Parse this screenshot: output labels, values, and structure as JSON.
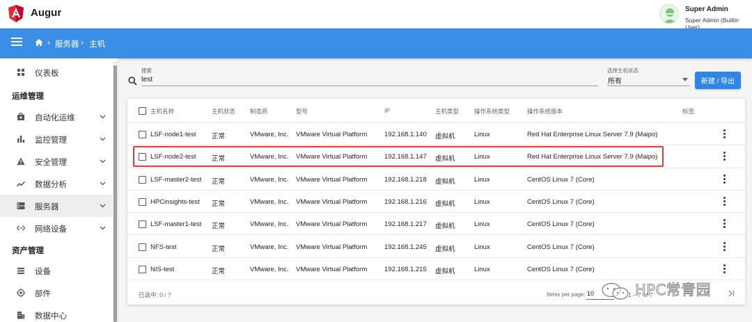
{
  "app": {
    "title": "Augur"
  },
  "user": {
    "name": "Super Admin",
    "role": "Super Admin (Builtin User)"
  },
  "breadcrumb": {
    "items": [
      "服务器",
      "主机"
    ]
  },
  "sidebar": {
    "items": [
      {
        "label": "仪表板",
        "icon": "dashboard-icon"
      },
      {
        "section": "运维管理"
      },
      {
        "label": "自动化运维",
        "icon": "briefcase-icon",
        "expandable": true
      },
      {
        "label": "监控管理",
        "icon": "bar-chart-icon",
        "expandable": true
      },
      {
        "label": "安全管理",
        "icon": "warning-icon",
        "expandable": true
      },
      {
        "label": "数据分析",
        "icon": "trending-icon",
        "expandable": true
      },
      {
        "label": "服务器",
        "icon": "server-icon",
        "expandable": true,
        "active": true
      },
      {
        "label": "网络设备",
        "icon": "code-icon",
        "expandable": true
      },
      {
        "section": "资产管理"
      },
      {
        "label": "设备",
        "icon": "list-icon"
      },
      {
        "label": "部件",
        "icon": "component-icon"
      },
      {
        "label": "数据中心",
        "icon": "building-icon"
      }
    ]
  },
  "filters": {
    "search_caption": "搜索",
    "search_value": "test",
    "status_caption": "选择主机状态",
    "status_value": "所有",
    "new_button": "新建 / 导出"
  },
  "table": {
    "columns": [
      "主机名称",
      "主机状态",
      "制造商",
      "型号",
      "IP",
      "主机类型",
      "操作系统类型",
      "操作系统版本",
      "标签"
    ],
    "rows": [
      [
        "LSF-node1-test",
        "正常",
        "VMware, Inc.",
        "VMware Virtual Platform",
        "192.168.1.140",
        "虚拟机",
        "Linux",
        "Red Hat Enterprise Linux Server 7.9 (Maipo)",
        ""
      ],
      [
        "LSF-node2-test",
        "正常",
        "VMware, Inc.",
        "VMware Virtual Platform",
        "192.168.1.147",
        "虚拟机",
        "Linux",
        "Red Hat Enterprise Linux Server 7.9 (Maipo)",
        ""
      ],
      [
        "LSF-master2-test",
        "正常",
        "VMware, Inc.",
        "VMware Virtual Platform",
        "192.168.1.218",
        "虚拟机",
        "Linux",
        "CentOS Linux 7 (Core)",
        ""
      ],
      [
        "HPCinsights-test",
        "正常",
        "VMware, Inc.",
        "VMware Virtual Platform",
        "192.168.1.216",
        "虚拟机",
        "Linux",
        "CentOS Linux 7 (Core)",
        ""
      ],
      [
        "LSF-master1-test",
        "正常",
        "VMware, Inc.",
        "VMware Virtual Platform",
        "192.168.1.217",
        "虚拟机",
        "Linux",
        "CentOS Linux 7 (Core)",
        ""
      ],
      [
        "NFS-test",
        "正常",
        "VMware, Inc.",
        "VMware Virtual Platform",
        "192.168.1.245",
        "虚拟机",
        "Linux",
        "CentOS Linux 7 (Core)",
        ""
      ],
      [
        "NIS-test",
        "正常",
        "VMware, Inc.",
        "VMware Virtual Platform",
        "192.168.1.215",
        "虚拟机",
        "Linux",
        "CentOS Linux 7 (Core)",
        ""
      ]
    ],
    "highlighted_row": 1
  },
  "footer": {
    "selected": "已选中: 0 / 7",
    "items_per_page_label": "Items per page:",
    "items_per_page": "10",
    "range": "1 – 7 of 7"
  },
  "watermark": {
    "text": "HPC常青园"
  },
  "colors": {
    "primary": "#3a8ee6",
    "button": "#2f86e6",
    "highlight": "#e53935",
    "logo": "#dd2c2c"
  }
}
